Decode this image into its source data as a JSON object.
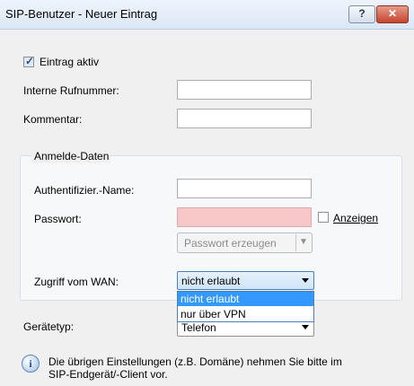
{
  "window": {
    "title": "SIP-Benutzer - Neuer Eintrag",
    "help_glyph": "?",
    "close_glyph": "✕"
  },
  "entry_active": {
    "label": "Eintrag aktiv",
    "checked": true
  },
  "internal_number": {
    "label": "Interne Rufnummer:",
    "value": ""
  },
  "comment": {
    "label": "Kommentar:",
    "value": ""
  },
  "login_group": {
    "title": "Anmelde-Daten",
    "auth_name": {
      "label": "Authentifizier.-Name:",
      "value": ""
    },
    "password": {
      "label": "Passwort:",
      "value": "",
      "field_color": "#f8c8c8"
    },
    "show_password": {
      "label": "Anzeigen",
      "checked": false
    },
    "generate_password": {
      "label": "Passwort erzeugen",
      "dropdown_glyph": "▼"
    },
    "wan_access": {
      "label": "Zugriff vom WAN:",
      "selected": "nicht erlaubt",
      "options": [
        "nicht erlaubt",
        "nur über VPN"
      ],
      "highlighted": "nicht erlaubt"
    }
  },
  "device_type": {
    "label": "Gerätetyp:",
    "value": "Telefon"
  },
  "info": {
    "icon": "info-icon",
    "line1": "Die übrigen Einstellungen (z.B. Domäne) nehmen Sie bitte im",
    "line2": "SIP-Endgerät/-Client vor."
  }
}
